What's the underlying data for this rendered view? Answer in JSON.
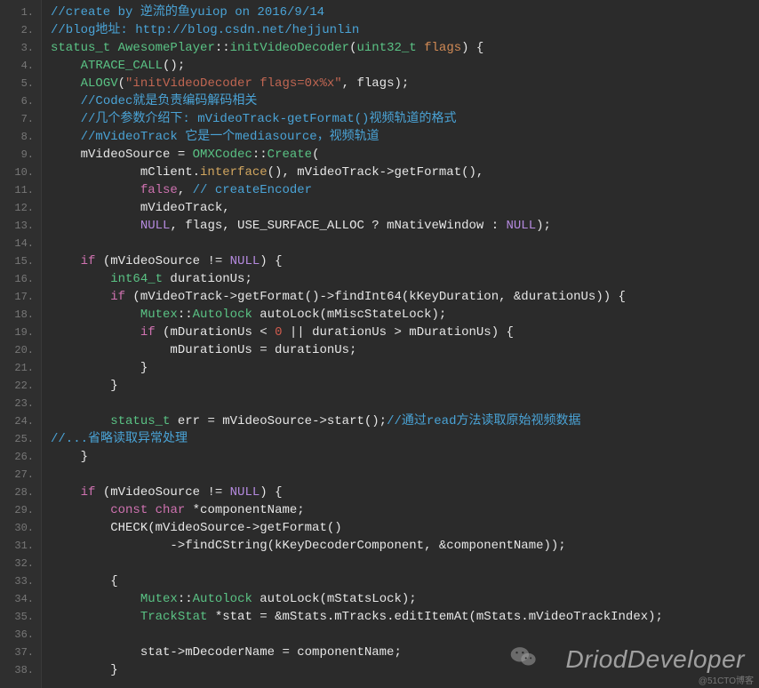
{
  "watermark": {
    "brand": "DriodDeveloper",
    "footer": "@51CTO博客"
  },
  "gutter": {
    "start": 1,
    "end": 38
  },
  "code_lines": [
    [
      [
        "comment",
        "//create by 逆流的鱼yuiop on 2016/9/14"
      ]
    ],
    [
      [
        "comment",
        "//blog地址: http://blog.csdn.net/hejjunlin"
      ]
    ],
    [
      [
        "type",
        "status_t"
      ],
      [
        "plain",
        " "
      ],
      [
        "class",
        "AwesomePlayer"
      ],
      [
        "punct",
        "::"
      ],
      [
        "func",
        "initVideoDecoder"
      ],
      [
        "punct",
        "("
      ],
      [
        "type",
        "uint32_t"
      ],
      [
        "plain",
        " "
      ],
      [
        "param",
        "flags"
      ],
      [
        "punct",
        ") {"
      ]
    ],
    [
      [
        "plain",
        "    "
      ],
      [
        "func",
        "ATRACE_CALL"
      ],
      [
        "punct",
        "();"
      ]
    ],
    [
      [
        "plain",
        "    "
      ],
      [
        "func",
        "ALOGV"
      ],
      [
        "punct",
        "("
      ],
      [
        "string",
        "\"initVideoDecoder flags=0x%x\""
      ],
      [
        "punct",
        ", flags);"
      ]
    ],
    [
      [
        "plain",
        "    "
      ],
      [
        "comment",
        "//Codec就是负责编码解码相关"
      ]
    ],
    [
      [
        "plain",
        "    "
      ],
      [
        "comment",
        "//几个参数介绍下: mVideoTrack-getFormat()视频轨道的格式"
      ]
    ],
    [
      [
        "plain",
        "    "
      ],
      [
        "comment",
        "//mVideoTrack 它是一个mediasource，视频轨道"
      ]
    ],
    [
      [
        "plain",
        "    mVideoSource = "
      ],
      [
        "class",
        "OMXCodec"
      ],
      [
        "punct",
        "::"
      ],
      [
        "func",
        "Create"
      ],
      [
        "punct",
        "("
      ]
    ],
    [
      [
        "plain",
        "            mClient."
      ],
      [
        "member",
        "interface"
      ],
      [
        "punct",
        "(), mVideoTrack->getFormat(),"
      ]
    ],
    [
      [
        "plain",
        "            "
      ],
      [
        "keyword",
        "false"
      ],
      [
        "punct",
        ", "
      ],
      [
        "comment",
        "// createEncoder"
      ]
    ],
    [
      [
        "plain",
        "            mVideoTrack,"
      ]
    ],
    [
      [
        "plain",
        "            "
      ],
      [
        "const",
        "NULL"
      ],
      [
        "plain",
        ", flags, USE_SURFACE_ALLOC ? mNativeWindow : "
      ],
      [
        "const",
        "NULL"
      ],
      [
        "punct",
        ");"
      ]
    ],
    [
      [
        "plain",
        ""
      ]
    ],
    [
      [
        "plain",
        "    "
      ],
      [
        "keyword",
        "if"
      ],
      [
        "plain",
        " (mVideoSource != "
      ],
      [
        "const",
        "NULL"
      ],
      [
        "punct",
        ") {"
      ]
    ],
    [
      [
        "plain",
        "        "
      ],
      [
        "type",
        "int64_t"
      ],
      [
        "plain",
        " durationUs;"
      ]
    ],
    [
      [
        "plain",
        "        "
      ],
      [
        "keyword",
        "if"
      ],
      [
        "plain",
        " (mVideoTrack->getFormat()->findInt64(kKeyDuration, &durationUs)) {"
      ]
    ],
    [
      [
        "plain",
        "            "
      ],
      [
        "class",
        "Mutex"
      ],
      [
        "punct",
        "::"
      ],
      [
        "class",
        "Autolock"
      ],
      [
        "plain",
        " autoLock(mMiscStateLock);"
      ]
    ],
    [
      [
        "plain",
        "            "
      ],
      [
        "keyword",
        "if"
      ],
      [
        "plain",
        " (mDurationUs < "
      ],
      [
        "number",
        "0"
      ],
      [
        "plain",
        " || durationUs > mDurationUs) {"
      ]
    ],
    [
      [
        "plain",
        "                mDurationUs = durationUs;"
      ]
    ],
    [
      [
        "plain",
        "            }"
      ]
    ],
    [
      [
        "plain",
        "        }"
      ]
    ],
    [
      [
        "plain",
        ""
      ]
    ],
    [
      [
        "plain",
        "        "
      ],
      [
        "type",
        "status_t"
      ],
      [
        "plain",
        " err = mVideoSource->start();"
      ],
      [
        "comment",
        "//通过read方法读取原始视频数据"
      ]
    ],
    [
      [
        "comment",
        "//...省略读取异常处理"
      ]
    ],
    [
      [
        "plain",
        "    }"
      ]
    ],
    [
      [
        "plain",
        ""
      ]
    ],
    [
      [
        "plain",
        "    "
      ],
      [
        "keyword",
        "if"
      ],
      [
        "plain",
        " (mVideoSource != "
      ],
      [
        "const",
        "NULL"
      ],
      [
        "punct",
        ") {"
      ]
    ],
    [
      [
        "plain",
        "        "
      ],
      [
        "keyword",
        "const"
      ],
      [
        "plain",
        " "
      ],
      [
        "keyword",
        "char"
      ],
      [
        "plain",
        " *componentName;"
      ]
    ],
    [
      [
        "plain",
        "        CHECK(mVideoSource->getFormat()"
      ]
    ],
    [
      [
        "plain",
        "                ->findCString(kKeyDecoderComponent, &componentName));"
      ]
    ],
    [
      [
        "plain",
        ""
      ]
    ],
    [
      [
        "plain",
        "        {"
      ]
    ],
    [
      [
        "plain",
        "            "
      ],
      [
        "class",
        "Mutex"
      ],
      [
        "punct",
        "::"
      ],
      [
        "class",
        "Autolock"
      ],
      [
        "plain",
        " autoLock(mStatsLock);"
      ]
    ],
    [
      [
        "plain",
        "            "
      ],
      [
        "class",
        "TrackStat"
      ],
      [
        "plain",
        " *stat = &mStats.mTracks.editItemAt(mStats.mVideoTrackIndex);"
      ]
    ],
    [
      [
        "plain",
        ""
      ]
    ],
    [
      [
        "plain",
        "            stat->mDecoderName = componentName;"
      ]
    ],
    [
      [
        "plain",
        "        }"
      ]
    ]
  ]
}
